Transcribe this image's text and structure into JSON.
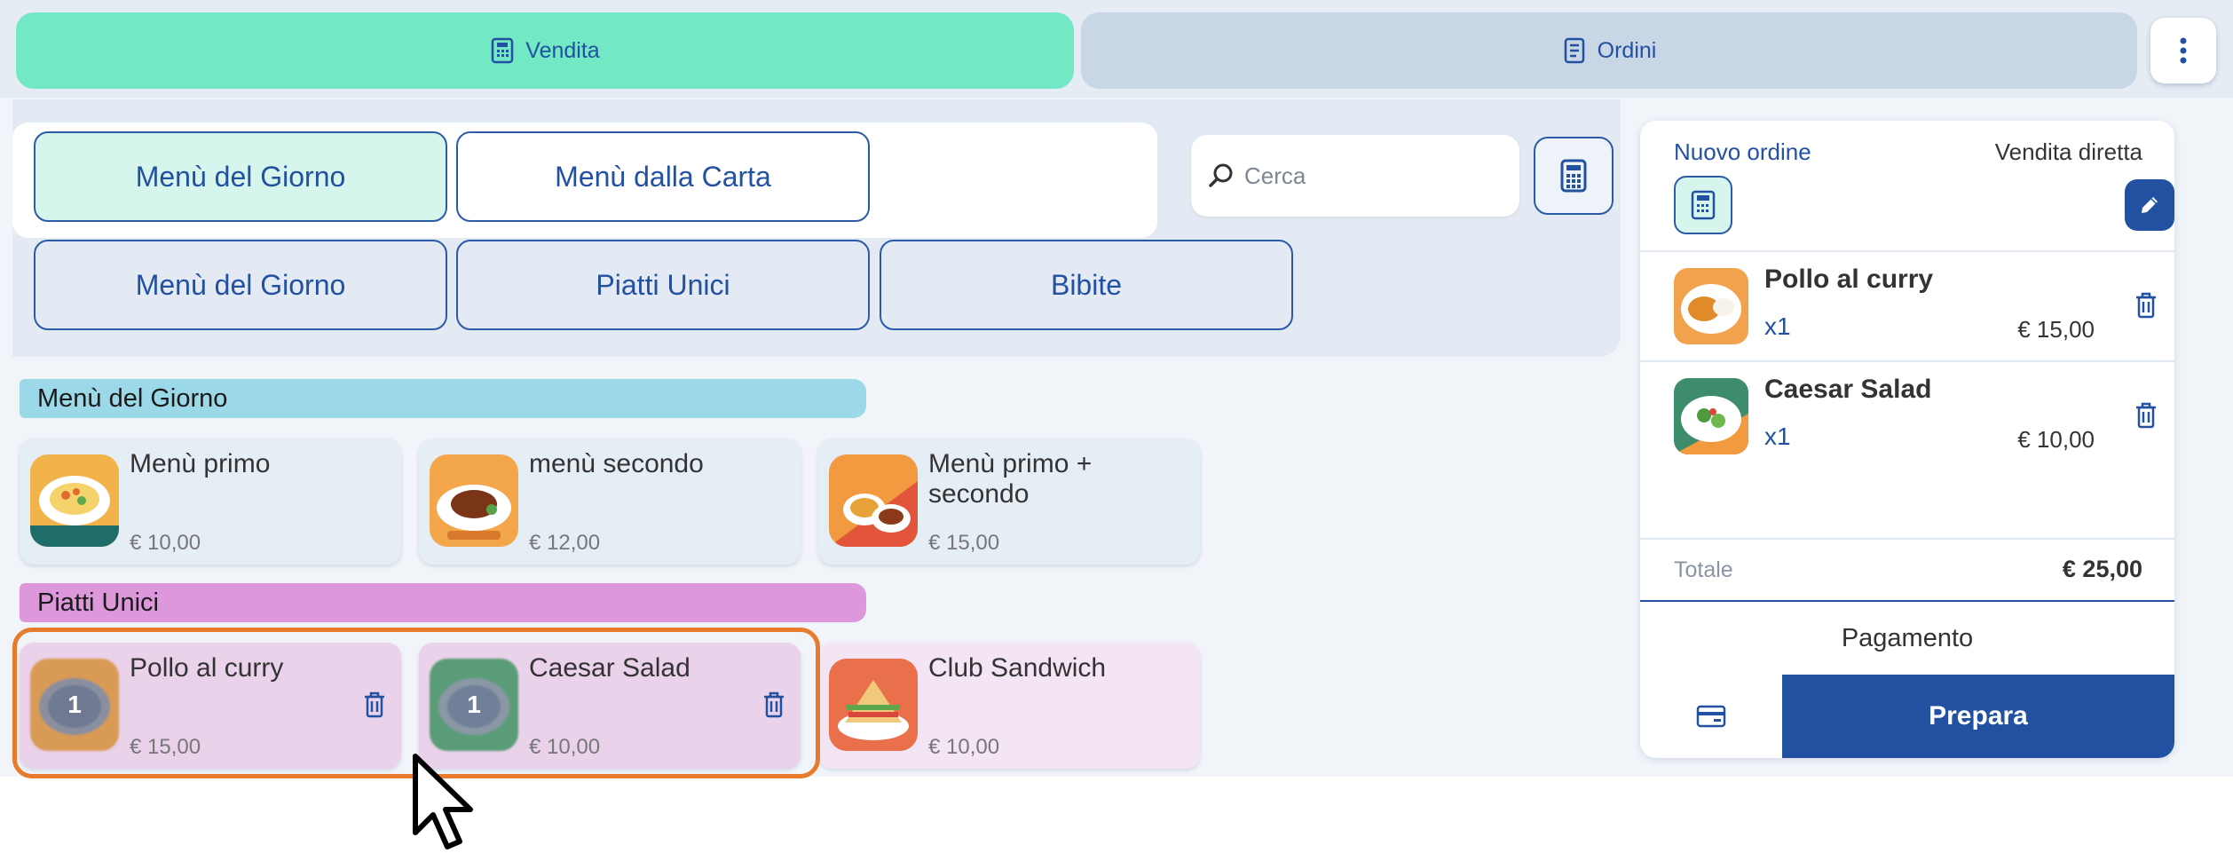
{
  "tabs": [
    {
      "label": "Vendita",
      "icon": "calculator-icon",
      "active": true
    },
    {
      "label": "Ordini",
      "icon": "document-icon",
      "active": false
    }
  ],
  "menu_categories": [
    "Menù del Giorno",
    "Menù dalla Carta"
  ],
  "sub_categories": [
    "Menù del Giorno",
    "Piatti Unici",
    "Bibite"
  ],
  "search": {
    "placeholder": "Cerca"
  },
  "sections": [
    {
      "title": "Menù del Giorno",
      "products": [
        {
          "name": "Menù primo",
          "price": "€ 10,00",
          "image": "pasta-image"
        },
        {
          "name": "menù secondo",
          "price": "€ 12,00",
          "image": "steak-image"
        },
        {
          "name": "Menù primo + secondo",
          "price": "€ 15,00",
          "image": "combo-image"
        }
      ]
    },
    {
      "title": "Piatti Unici",
      "products": [
        {
          "name": "Pollo al curry",
          "price": "€ 15,00",
          "qty": "1",
          "image": "curry-image"
        },
        {
          "name": "Caesar Salad",
          "price": "€ 10,00",
          "qty": "1",
          "image": "salad-image"
        },
        {
          "name": "Club Sandwich",
          "price": "€ 10,00",
          "image": "sandwich-image"
        }
      ]
    }
  ],
  "order": {
    "title": "Nuovo ordine",
    "mode": "Vendita diretta",
    "items": [
      {
        "name": "Pollo al curry",
        "qty": "x1",
        "price": "€ 15,00"
      },
      {
        "name": "Caesar Salad",
        "qty": "x1",
        "price": "€ 10,00"
      }
    ],
    "total_label": "Totale",
    "total_value": "€ 25,00",
    "payment_label": "Pagamento",
    "prepare_label": "Prepara"
  },
  "colors": {
    "accent": "#2251a1",
    "vendita_tab": "#72e8c4",
    "highlight": "#e87a2c"
  }
}
